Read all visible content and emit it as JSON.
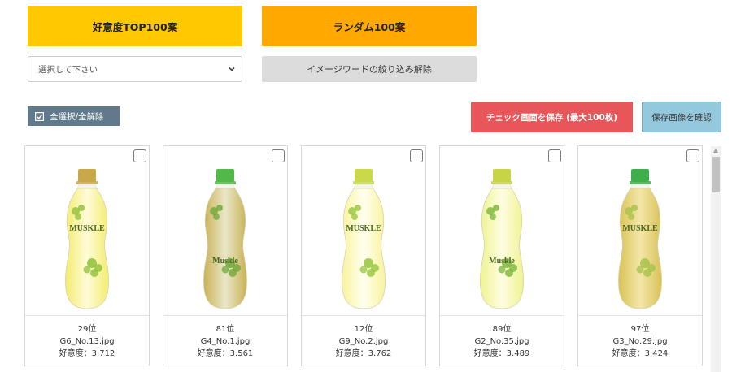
{
  "buttons": {
    "top100": "好意度TOP100案",
    "random100": "ランダム100案",
    "clear_filter": "イメージワードの絞り込み解除",
    "select_all": "全選択/全解除",
    "save": "チェック画面を保存 (最大100枚)",
    "confirm": "保存画像を確認"
  },
  "filter": {
    "selected": "選択して下さい"
  },
  "accent_colors": {
    "top100": "#ffc800",
    "random100": "#ffa800",
    "save": "#e8565a",
    "confirm": "#94c8dc",
    "select_all": "#607a8b"
  },
  "icons": {
    "select_all": "checkbox-checked-icon",
    "dropdown": "chevron-down-icon"
  },
  "cards": [
    {
      "rank": "29位",
      "file": "G6_No.13.jpg",
      "score": "好意度：3.712"
    },
    {
      "rank": "81位",
      "file": "G4_No.1.jpg",
      "score": "好意度：3.561"
    },
    {
      "rank": "12位",
      "file": "G9_No.2.jpg",
      "score": "好意度：3.762"
    },
    {
      "rank": "89位",
      "file": "G2_No.35.jpg",
      "score": "好意度：3.489"
    },
    {
      "rank": "97位",
      "file": "G3_No.29.jpg",
      "score": "好意度：3.424"
    }
  ],
  "bottle_labels": [
    "MUSKLE",
    "Muskle",
    "MUSKLE",
    "Muskle",
    "MUSKLE"
  ]
}
